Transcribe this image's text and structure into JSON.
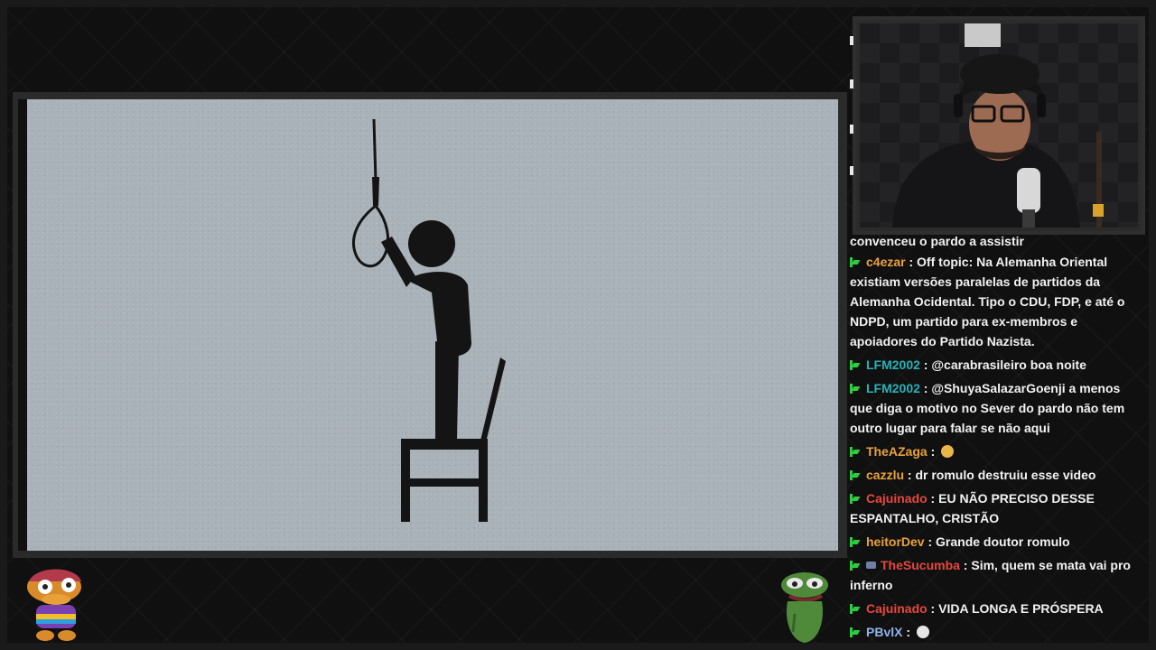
{
  "colors": {
    "background": "#101010",
    "video_bg": "#a9b2b8",
    "chat_text": "#f2f2f2",
    "badge_green": "#2ecc40",
    "user_orange": "#e9a23b",
    "user_teal": "#27b3b8",
    "user_red": "#e8473f",
    "user_blue": "#8fb2e8"
  },
  "video": {
    "scene": "figure-on-chair-with-noose"
  },
  "webcam": {
    "scene": "streamer-with-headphones-and-microphone"
  },
  "chat": {
    "messages": [
      {
        "badge": "green-k-icon",
        "user": "",
        "user_color": "",
        "text": "convenceu o pardo a assistir"
      },
      {
        "badge": "green-k-icon",
        "user": "c4ezar",
        "user_color": "#e9a23b",
        "text": "Off topic: Na Alemanha Oriental existiam versões paralelas de partidos da Alemanha Ocidental. Tipo o CDU, FDP, e até o NDPD, um partido para ex-membros e apoiadores do Partido Nazista."
      },
      {
        "badge": "green-k-icon",
        "user": "LFM2002",
        "user_color": "#27b3b8",
        "text": "@carabrasileiro boa noite"
      },
      {
        "badge": "green-k-icon",
        "user": "LFM2002",
        "user_color": "#27b3b8",
        "text": "@ShuyaSalazarGoenji a menos que diga o motivo no Sever do pardo não tem outro lugar para falar se não aqui"
      },
      {
        "badge": "green-k-icon",
        "user": "TheAZaga",
        "user_color": "#e9a23b",
        "text": "",
        "emote": "nerd-face-emoji"
      },
      {
        "badge": "green-k-icon",
        "user": "cazzlu",
        "user_color": "#e9a23b",
        "text": "dr romulo destruiu esse video"
      },
      {
        "badge": "green-k-icon",
        "user": "Cajuinado",
        "user_color": "#e8473f",
        "text": "EU NÃO PRECISO DESSE ESPANTALHO, CRISTÃO"
      },
      {
        "badge": "green-k-icon",
        "user": "heitorDev",
        "user_color": "#e9a23b",
        "text": "Grande doutor romulo"
      },
      {
        "badge": "green-k-icon",
        "user": "TheSucumba",
        "user_color": "#e8473f",
        "text": "Sim, quem se mata vai pro inferno",
        "extra_icon": "sub-badge-icon"
      },
      {
        "badge": "green-k-icon",
        "user": "Cajuinado",
        "user_color": "#e8473f",
        "text": "VIDA LONGA E PRÓSPERA"
      },
      {
        "badge": "green-k-icon",
        "user": "PBvlX",
        "user_color": "#8fb2e8",
        "text": "",
        "emote": "skull-emoji"
      }
    ]
  },
  "overlays": {
    "left_mascot": "cartoon-mascot-with-glasses",
    "right_mascot": "pepe-frog-sticker"
  }
}
